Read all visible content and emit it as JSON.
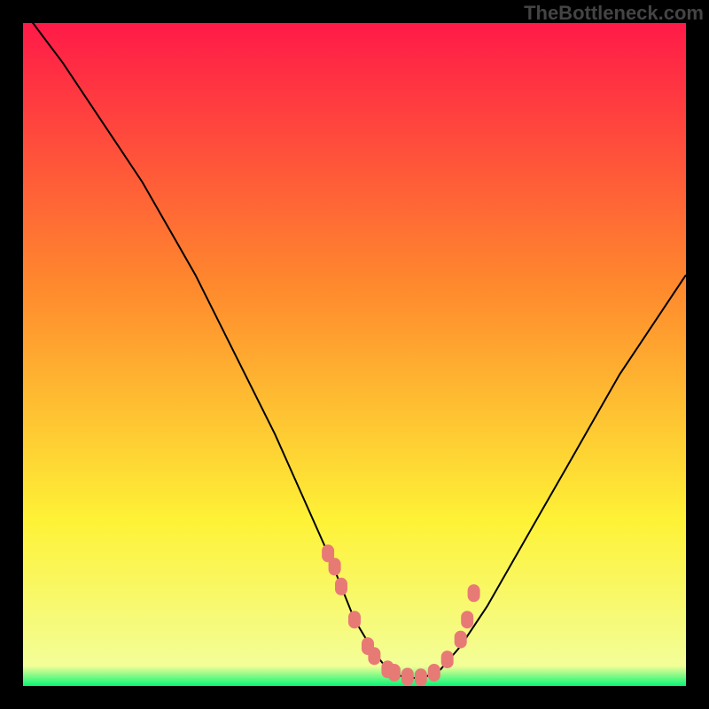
{
  "watermark": "TheBottleneck.com",
  "chart_data": {
    "type": "line",
    "title": "",
    "xlabel": "",
    "ylabel": "",
    "xlim": [
      0,
      100
    ],
    "ylim": [
      0,
      100
    ],
    "gradient_background": {
      "top_color": "#ff1a48",
      "mid_color_1": "#ff8a2d",
      "mid_color_2": "#fef236",
      "bottom_color": "#08f675"
    },
    "series": [
      {
        "name": "bottleneck-curve",
        "x": [
          0,
          3,
          6,
          10,
          14,
          18,
          22,
          26,
          30,
          34,
          38,
          42,
          46,
          50,
          53,
          55,
          57,
          59,
          61,
          63,
          66,
          70,
          74,
          78,
          82,
          86,
          90,
          94,
          98,
          100
        ],
        "y": [
          102,
          98,
          94,
          88,
          82,
          76,
          69,
          62,
          54,
          46,
          38,
          29,
          20,
          10,
          5,
          2.5,
          1.5,
          1.2,
          1.5,
          2.5,
          6,
          12,
          19,
          26,
          33,
          40,
          47,
          53,
          59,
          62
        ],
        "color": "#000000"
      }
    ],
    "marker_series": {
      "name": "marker-dots",
      "x": [
        46,
        47,
        48,
        50,
        52,
        53,
        55,
        56,
        58,
        60,
        62,
        64,
        66,
        67,
        68
      ],
      "y": [
        20,
        18,
        15,
        10,
        6,
        4.5,
        2.5,
        2,
        1.4,
        1.3,
        2,
        4,
        7,
        10,
        14
      ],
      "color": "#e87a76"
    }
  }
}
